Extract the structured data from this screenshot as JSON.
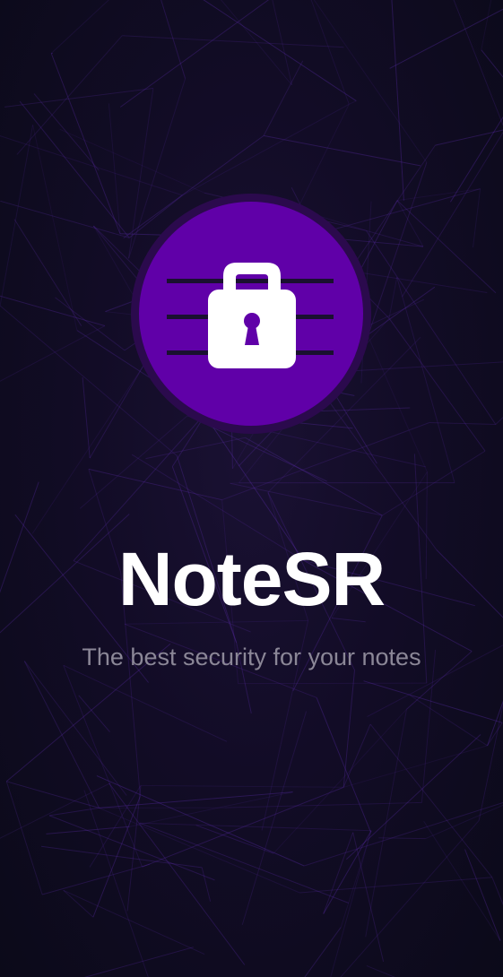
{
  "app": {
    "name": "NoteSR",
    "tagline": "The best security for your notes"
  },
  "logo": {
    "icon": "lock-icon",
    "circle_color": "#6000a8",
    "ring_color": "#2b0a4d",
    "lock_color": "#ffffff",
    "line_color": "#1a1030"
  },
  "background": {
    "color": "#0c0a1c",
    "pattern_color": "#5a2ca8"
  }
}
